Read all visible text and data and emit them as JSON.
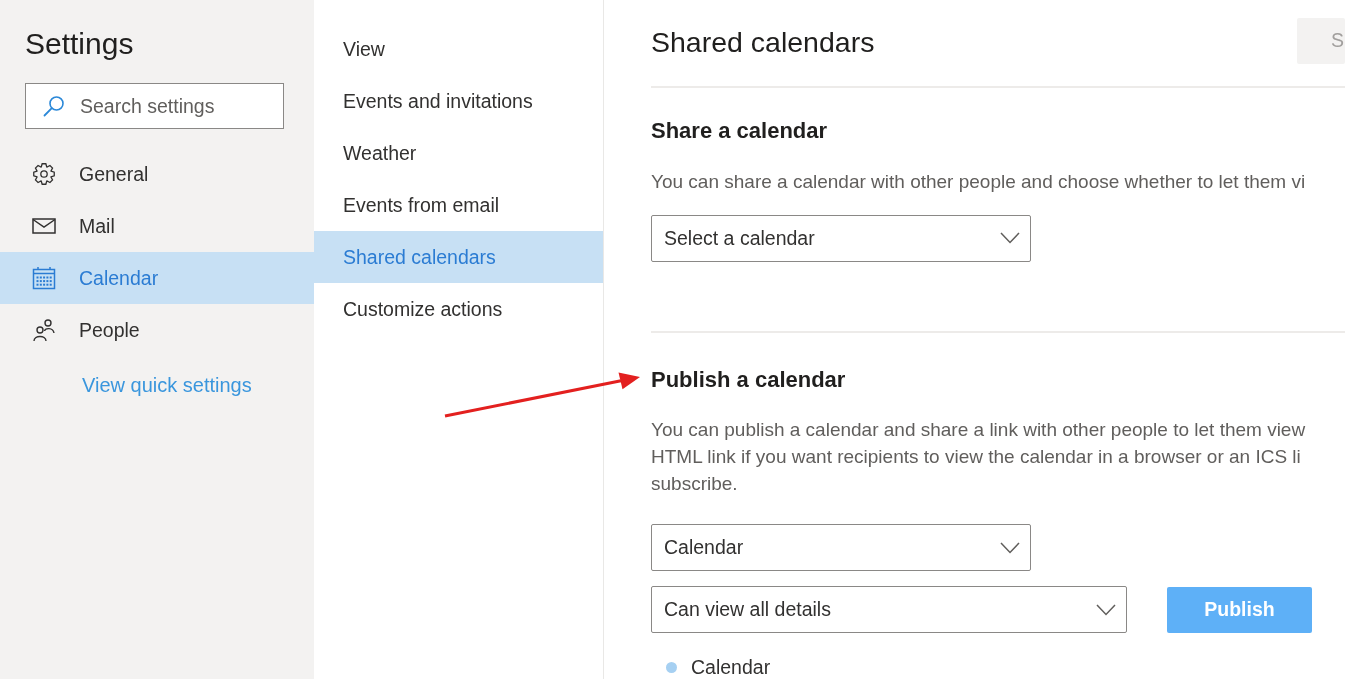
{
  "settings_pane": {
    "title": "Settings",
    "search": {
      "placeholder": "Search settings"
    },
    "items": [
      {
        "kind": "general",
        "label": "General",
        "selected": false
      },
      {
        "kind": "mail",
        "label": "Mail",
        "selected": false
      },
      {
        "kind": "calendar",
        "label": "Calendar",
        "selected": true
      },
      {
        "kind": "people",
        "label": "People",
        "selected": false
      }
    ],
    "link": "View quick settings"
  },
  "calendar_menu": {
    "items": [
      {
        "label": "View",
        "selected": false
      },
      {
        "label": "Events and invitations",
        "selected": false
      },
      {
        "label": "Weather",
        "selected": false
      },
      {
        "label": "Events from email",
        "selected": false
      },
      {
        "label": "Shared calendars",
        "selected": true
      },
      {
        "label": "Customize actions",
        "selected": false
      }
    ]
  },
  "content": {
    "title": "Shared calendars",
    "save_button": {
      "label": "S",
      "disabled": true
    },
    "share": {
      "heading": "Share a calendar",
      "description": "You can share a calendar with other people and choose whether to let them vi",
      "dropdown": {
        "value": "Select a calendar"
      }
    },
    "publish": {
      "heading": "Publish a calendar",
      "description_lines": [
        "You can publish a calendar and share a link with other people to let them view",
        "HTML link if you want recipients to view the calendar in a browser or an ICS li",
        "subscribe."
      ],
      "calendar_dropdown": {
        "value": "Calendar"
      },
      "permission_dropdown": {
        "value": "Can view all details"
      },
      "publish_button": {
        "label": "Publish",
        "disabled": false
      },
      "published_calendars": [
        {
          "name": "Calendar",
          "color": "#a6d0f2"
        }
      ]
    }
  },
  "annotations": [
    {
      "kind": "arrow"
    }
  ]
}
